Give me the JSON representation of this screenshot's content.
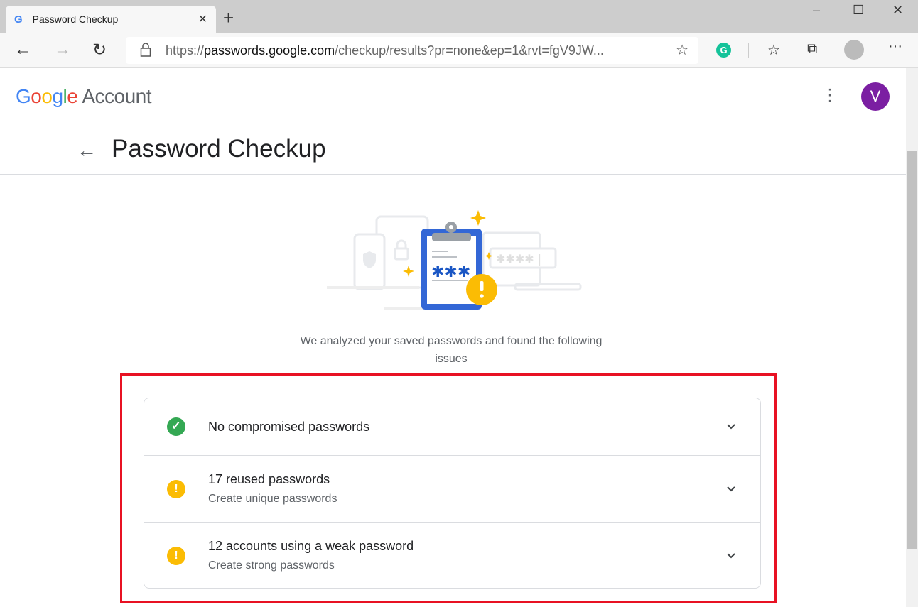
{
  "browser": {
    "tab_title": "Password Checkup",
    "url_prefix": "https://",
    "url_domain": "passwords.google.com",
    "url_path": "/checkup/results?pr=none&ep=1&rvt=fgV9JW...",
    "extension_letter": "G"
  },
  "header": {
    "logo_google": [
      "G",
      "o",
      "o",
      "g",
      "l",
      "e"
    ],
    "logo_account": "Account",
    "avatar_letter": "V"
  },
  "page": {
    "title": "Password Checkup",
    "intro": "We analyzed your saved passwords and found the following issues"
  },
  "colors": {
    "success": "#34a853",
    "warning": "#fbbc04",
    "highlight": "#e81123",
    "avatar": "#7b1fa2"
  },
  "issues": [
    {
      "title": "No compromised passwords",
      "subtitle": "",
      "status": "ok",
      "icon": "check-circle-icon"
    },
    {
      "title": "17 reused passwords",
      "subtitle": "Create unique passwords",
      "status": "warning",
      "icon": "warning-circle-icon"
    },
    {
      "title": "12 accounts using a weak password",
      "subtitle": "Create strong passwords",
      "status": "warning",
      "icon": "warning-circle-icon"
    }
  ]
}
